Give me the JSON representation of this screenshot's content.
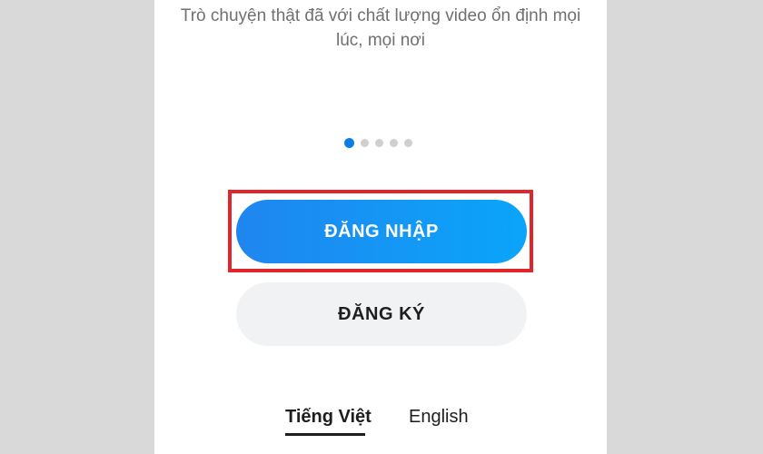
{
  "onboarding": {
    "tagline": "Trò chuyện thật đã với chất lượng video ổn định mọi lúc, mọi nơi",
    "page_indicator": {
      "total": 5,
      "active": 1
    }
  },
  "actions": {
    "login_label": "ĐĂNG NHẬP",
    "signup_label": "ĐĂNG KÝ"
  },
  "language": {
    "options": [
      "Tiếng Việt",
      "English"
    ],
    "selected": "Tiếng Việt"
  },
  "colors": {
    "login_start": "#1f86ef",
    "login_end": "#0aa5fb",
    "highlight": "#e0262b",
    "active_dot": "#0a7de6"
  }
}
